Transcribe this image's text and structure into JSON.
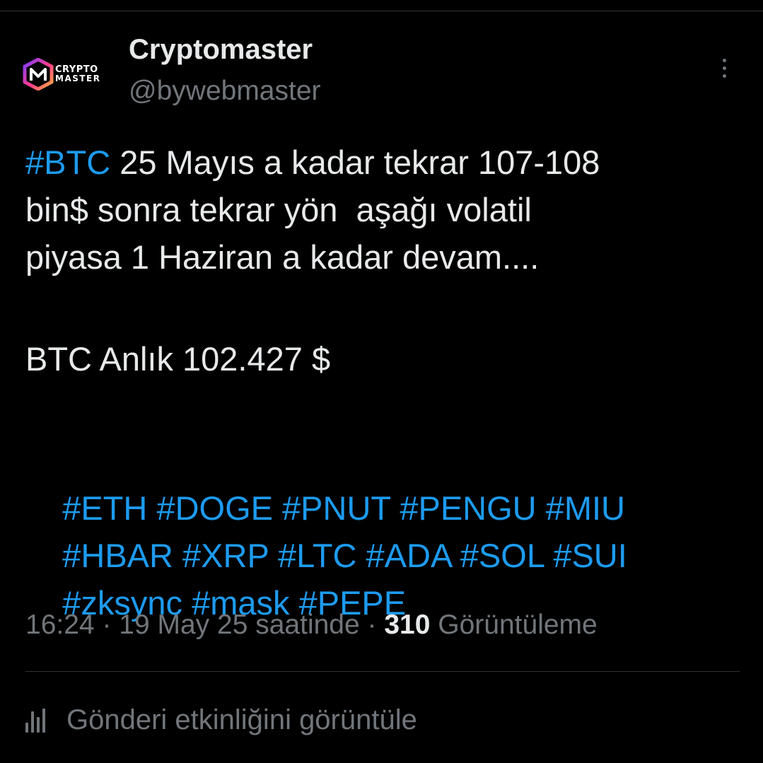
{
  "author": {
    "avatar": {
      "logo_line1": "CRYPTO",
      "logo_line2": "MASTER",
      "colors": [
        "#7a3cff",
        "#ff3c8a",
        "#ffb23c"
      ]
    },
    "display_name": "Cryptomaster",
    "handle": "@bywebmaster"
  },
  "menu_icon": "more-vertical-icon",
  "tweet": {
    "line1": {
      "tag": "#BTC",
      "text": " 25 Mayıs a kadar tekrar 107-108"
    },
    "line2": "bin$ sonra tekrar yön  aşağı volatil",
    "line3": "piyasa 1 Haziran a kadar devam....",
    "line4": "BTC Anlık 102.427 $",
    "hashtags_row1": [
      "#ETH",
      "#DOGE",
      "#PNUT",
      "#PENGU",
      "#MIU"
    ],
    "hashtags_row2": [
      "#HBAR",
      "#XRP",
      "#LTC",
      "#ADA",
      "#SOL",
      "#SUI"
    ],
    "hashtags_row3": [
      "#zksync",
      "#mask",
      "#PEPE"
    ]
  },
  "meta": {
    "time": "16:24",
    "separator": " · ",
    "date": "19 May 25 saatinde",
    "views_count": "310",
    "views_label": " Görüntüleme"
  },
  "activity": {
    "icon": "analytics-bar-chart-icon",
    "label": "Gönderi etkinliğini görüntüle"
  },
  "colors": {
    "background": "#000000",
    "text": "#e7e9ea",
    "secondary": "#71767b",
    "link": "#1d9bf0",
    "divider": "#2f3336"
  }
}
